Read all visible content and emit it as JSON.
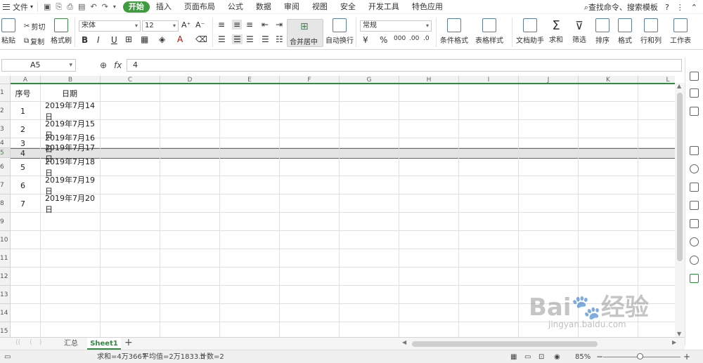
{
  "menubar": {
    "file_label": "文件",
    "tabs": [
      "开始",
      "插入",
      "页面布局",
      "公式",
      "数据",
      "审阅",
      "视图",
      "安全",
      "开发工具",
      "特色应用"
    ],
    "active_tab": "开始",
    "search_label": "查找命令、搜索模板",
    "help_icon": "?"
  },
  "ribbon": {
    "paste_label": "粘贴",
    "cut_label": "剪切",
    "copy_label": "复制",
    "format_painter_label": "格式刷",
    "font_name": "宋体",
    "font_size": "12",
    "bold": "B",
    "italic": "I",
    "underline": "U",
    "font_color_glyph": "A",
    "merge_center_label": "合并居中",
    "wrap_text_label": "自动换行",
    "number_format": "常规",
    "percent_glyph": "%",
    "dec_inc": ".00",
    "dec_dec": ".0",
    "cond_format_label": "条件格式",
    "table_style_label": "表格样式",
    "doc_helper_label": "文档助手",
    "sum_label": "求和",
    "filter_label": "筛选",
    "sort_label": "排序",
    "format_label": "格式",
    "rows_cols_label": "行和列",
    "worksheet_label": "工作表"
  },
  "formula_bar": {
    "cell_ref": "A5",
    "fx_label": "fx",
    "value": "4"
  },
  "grid": {
    "columns": [
      "A",
      "B",
      "C",
      "D",
      "E",
      "F",
      "G",
      "H",
      "I",
      "J",
      "K",
      "L"
    ],
    "row_numbers": [
      "1",
      "2",
      "3",
      "4",
      "5",
      "6",
      "7",
      "8",
      "9",
      "10",
      "11",
      "12",
      "13",
      "14",
      "15"
    ],
    "header": {
      "a": "序号",
      "b": "日期"
    },
    "rows": [
      {
        "a": "1",
        "b": "2019年7月14日"
      },
      {
        "a": "2",
        "b": "2019年7月15日"
      },
      {
        "a": "3",
        "b": "2019年7月16日"
      },
      {
        "a": "4",
        "b": "2019年7月17日"
      },
      {
        "a": "5",
        "b": "2019年7月18日"
      },
      {
        "a": "6",
        "b": "2019年7月19日"
      },
      {
        "a": "7",
        "b": "2019年7月20日"
      }
    ],
    "selected_row": "5"
  },
  "sheets": {
    "tabs": [
      "汇总",
      "Sheet1"
    ],
    "active": "Sheet1",
    "add_label": "+"
  },
  "status": {
    "sum": "求和=4万3667",
    "average": "平均值=2万1833.5",
    "count": "计数=2",
    "zoom": "85%",
    "zoom_minus": "−",
    "zoom_plus": "+"
  },
  "watermark": {
    "text": "Bai🐾经验",
    "sub": "jingyan.baidu.com"
  },
  "colors": {
    "accent": "#3d9c3d",
    "selection": "#2e8b3e"
  }
}
